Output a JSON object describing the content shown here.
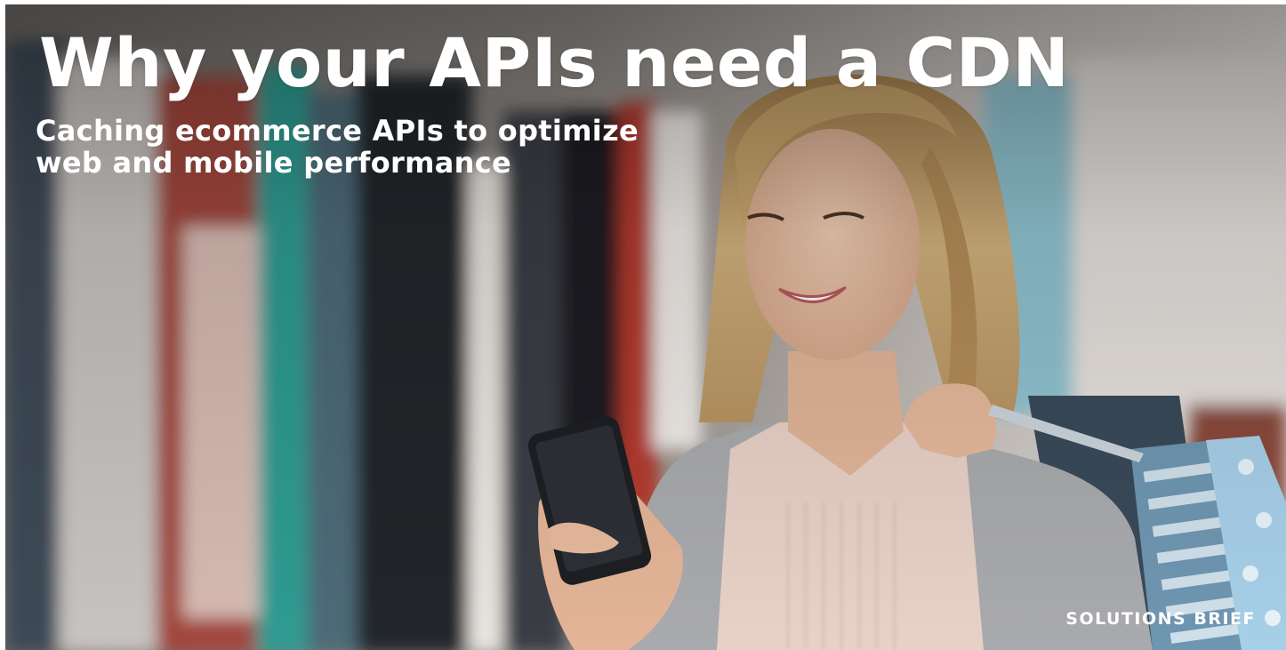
{
  "hero": {
    "headline": "Why your APIs need a CDN",
    "subhead": "Caching ecommerce APIs to optimize web and mobile performance",
    "badge": "SOLUTIONS BRIEF",
    "image_subject": "woman-smiling-at-phone-in-clothing-store",
    "colors": {
      "text": "#ffffff",
      "wall": "#d9d4cf",
      "skin": "#e9c2a6",
      "hair": "#c9a66b",
      "cardigan": "#a9aaad",
      "blouse": "#e8d1c7",
      "phone": "#1d1f22",
      "bag_blue": "#9cc5df",
      "bag_stripe": "#5c8aa8"
    }
  }
}
